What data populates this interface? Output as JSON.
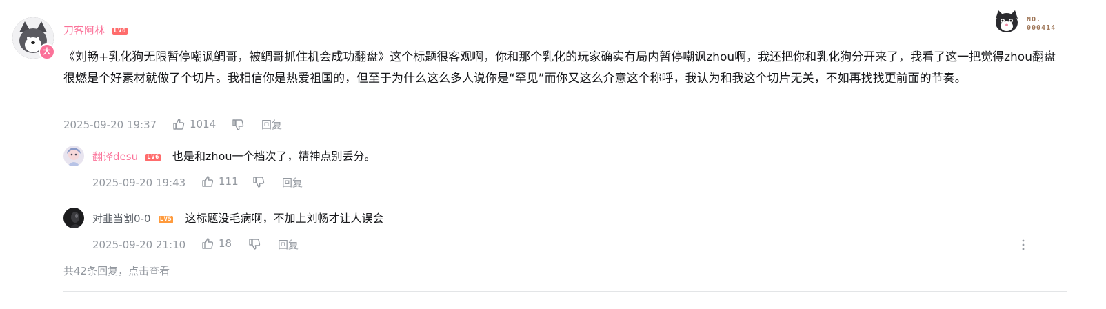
{
  "main_comment": {
    "username": "刀客阿林",
    "level": "LV6",
    "vip_badge": "大",
    "text": "《刘畅+乳化狗无限暂停嘲讽鲷哥，被鲷哥抓住机会成功翻盘》这个标题很客观啊，你和那个乳化的玩家确实有局内暂停嘲讽zhou啊，我还把你和乳化狗分开来了，我看了这一把觉得zhou翻盘很燃是个好素材就做了个切片。我相信你是热爱祖国的，但至于为什么这么多人说你是“罕见”而你又这么介意这个称呼，我认为和我这个切片无关，不如再找找更前面的节奏。",
    "time": "2025-09-20 19:37",
    "likes": "1014",
    "reply_label": "回复",
    "fan_badge_line1": "NO.",
    "fan_badge_line2": "000414"
  },
  "replies": [
    {
      "username": "翻译desu",
      "level": "LV6",
      "text": "也是和zhou一个档次了，精神点别丢分。",
      "time": "2025-09-20 19:43",
      "likes": "111",
      "reply_label": "回复"
    },
    {
      "username": "对韭当割0-0",
      "level": "LV5",
      "text": "这标题没毛病啊，不加上刘畅才让人误会",
      "time": "2025-09-20 21:10",
      "likes": "18",
      "reply_label": "回复"
    }
  ],
  "view_more": "共42条回复，点击查看",
  "colors": {
    "accent_pink": "#fb7299",
    "meta_gray": "#9499a0",
    "lv6": "#ff6c6c",
    "lv5": "#ff9a3c"
  },
  "icons": {
    "like": "thumbs-up-icon",
    "dislike": "thumbs-down-icon",
    "more": "more-vertical-icon"
  }
}
